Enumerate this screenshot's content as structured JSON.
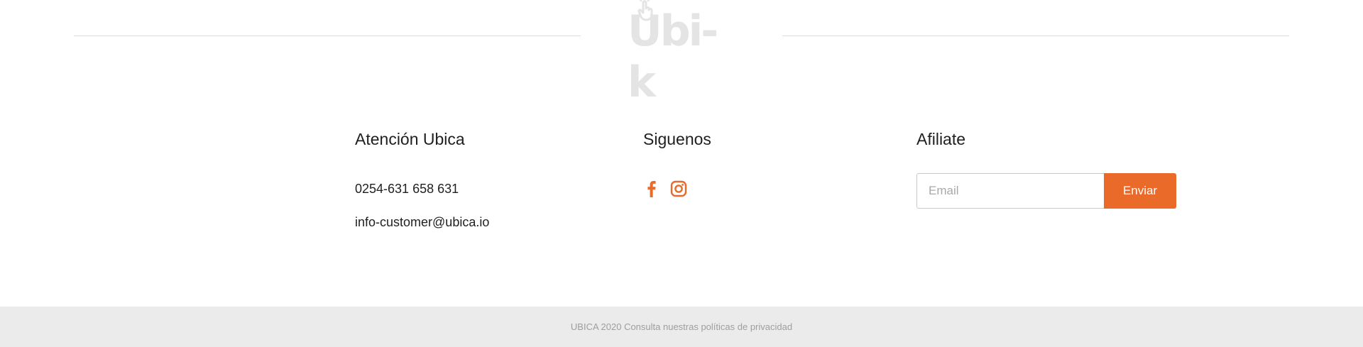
{
  "brand": {
    "logo_text": "Ubi-k",
    "logo_color": "#e4e4e4",
    "accent_color": "#ea6a2a"
  },
  "atencion": {
    "title": "Atención Ubica",
    "phone": "0254-631 658 631",
    "email": "info-customer@ubica.io"
  },
  "siguenos": {
    "title": "Siguenos",
    "icons": [
      "facebook-icon",
      "instagram-icon"
    ]
  },
  "afiliate": {
    "title": "Afiliate",
    "email_placeholder": "Email",
    "email_value": "",
    "submit_label": "Enviar"
  },
  "footer": {
    "text": "UBICA 2020 Consulta nuestras políticas de privacidad"
  }
}
